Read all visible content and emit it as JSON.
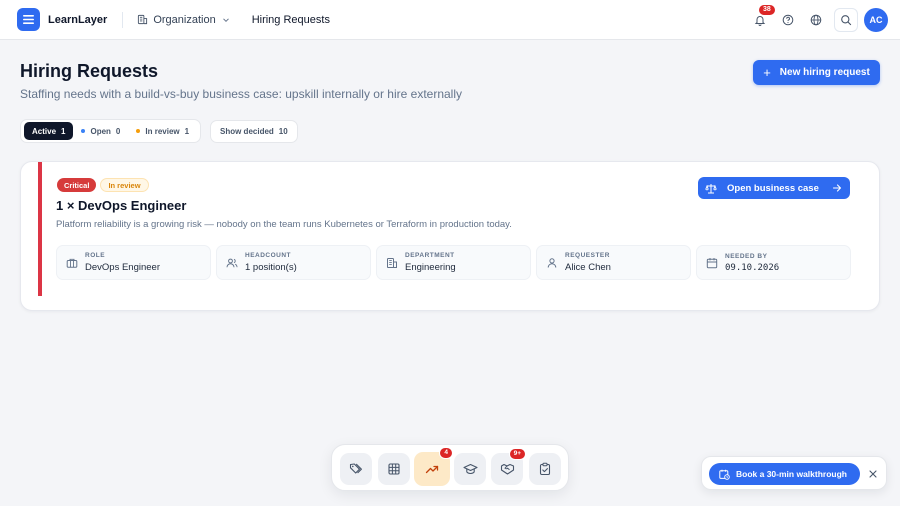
{
  "app": {
    "name": "LearnLayer"
  },
  "breadcrumb": {
    "org_label": "Organization",
    "current": "Hiring Requests"
  },
  "header": {
    "notification_count": "38",
    "avatar_initials": "AC"
  },
  "page": {
    "title": "Hiring Requests",
    "subtitle": "Staffing needs with a build-vs-buy business case: upskill internally or hire externally",
    "new_request_label": "New hiring request"
  },
  "filters": {
    "active": {
      "label": "Active",
      "count": "1"
    },
    "open": {
      "label": "Open",
      "count": "0",
      "dot_color": "#3b82f6"
    },
    "in_review": {
      "label": "In review",
      "count": "1",
      "dot_color": "#f59e0b"
    },
    "show_decided": {
      "label": "Show decided",
      "count": "10"
    }
  },
  "request": {
    "priority": "Critical",
    "status": "In review",
    "title": "1 × DevOps Engineer",
    "description": "Platform reliability is a growing risk — nobody on the team runs Kubernetes or Terraform in production today.",
    "case_button": "Open business case",
    "meta": {
      "role": {
        "label": "ROLE",
        "value": "DevOps Engineer"
      },
      "headcount": {
        "label": "HEADCOUNT",
        "value": "1 position(s)"
      },
      "department": {
        "label": "DEPARTMENT",
        "value": "Engineering"
      },
      "requester": {
        "label": "REQUESTER",
        "value": "Alice Chen"
      },
      "needed_by": {
        "label": "NEEDED BY",
        "value": "09.10.2026"
      }
    }
  },
  "dock": {
    "items": [
      {
        "icon": "tags-icon"
      },
      {
        "icon": "grid-icon"
      },
      {
        "icon": "trending-up-icon",
        "badge": "4",
        "active": true
      },
      {
        "icon": "graduation-cap-icon"
      },
      {
        "icon": "handshake-icon",
        "badge": "9+"
      },
      {
        "icon": "clipboard-check-icon"
      }
    ]
  },
  "walkthrough": {
    "label": "Book a 30-min walkthrough"
  },
  "colors": {
    "accent": "#2f6bf0",
    "critical": "#dc3545",
    "review": "#d9860b"
  }
}
